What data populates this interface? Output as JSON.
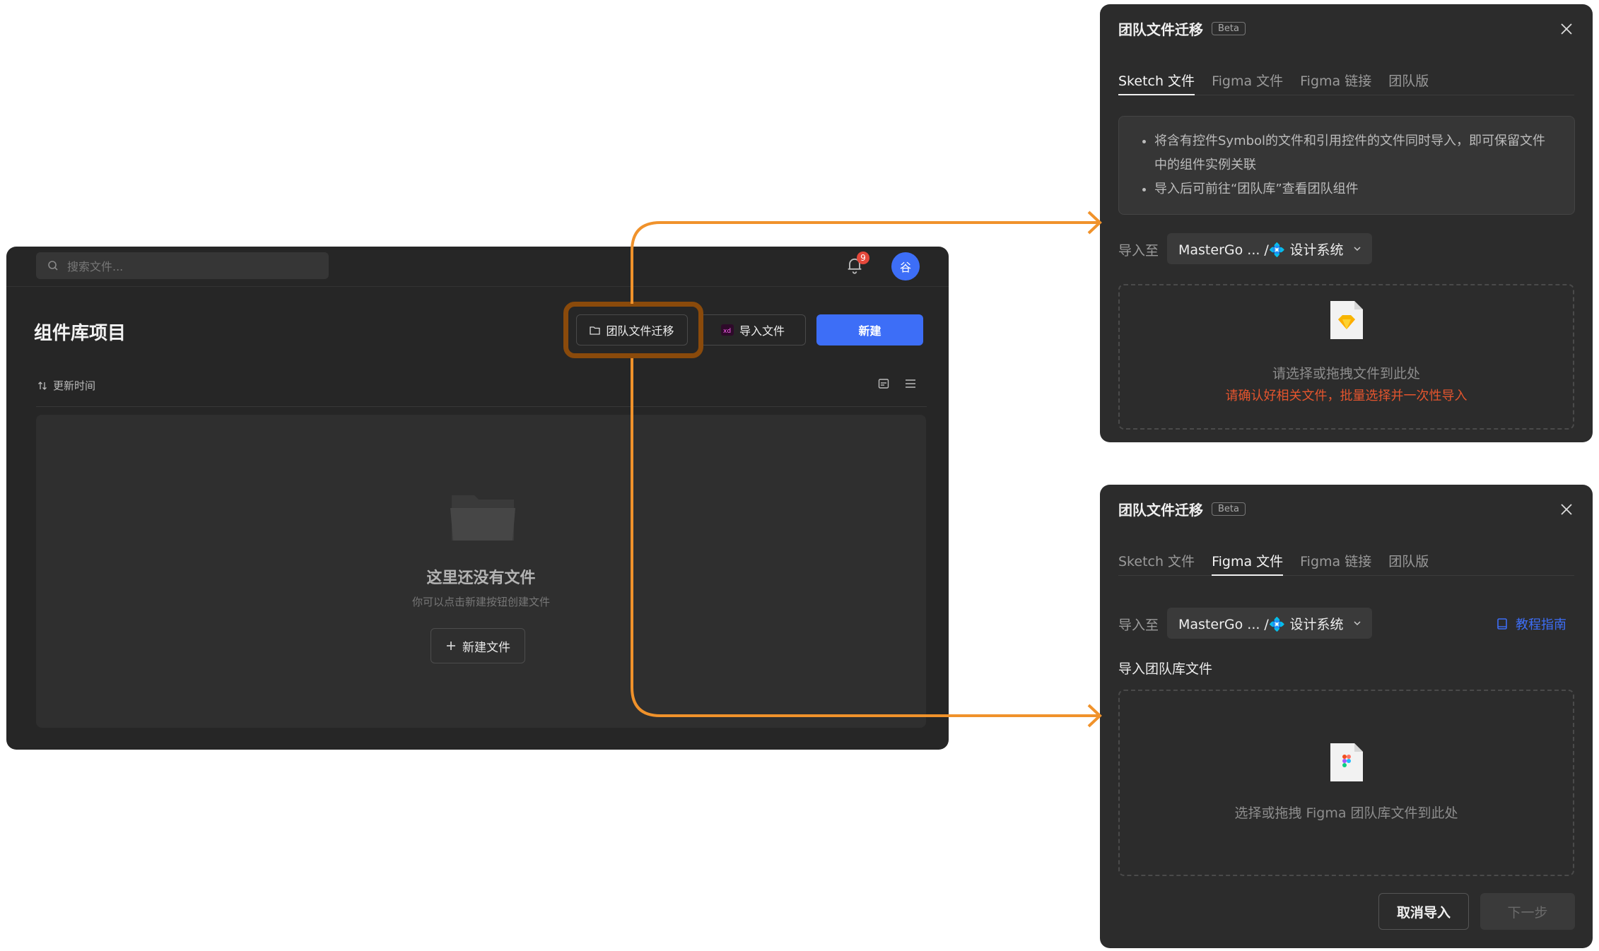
{
  "main": {
    "search_placeholder": "搜索文件...",
    "notification_count": "9",
    "avatar_initial": "谷",
    "page_title": "组件库项目",
    "buttons": {
      "migrate": "团队文件迁移",
      "import": "导入文件",
      "new": "新建"
    },
    "sort_label": "更新时间",
    "empty": {
      "title": "这里还没有文件",
      "subtitle": "你可以点击新建按钮创建文件",
      "new_file_button": "新建文件"
    }
  },
  "dialog_sketch": {
    "title": "团队文件迁移",
    "beta": "Beta",
    "tabs": [
      "Sketch 文件",
      "Figma 文件",
      "Figma 链接",
      "团队版"
    ],
    "active_tab": 0,
    "info": [
      "将含有控件Symbol的文件和引用控件的文件同时导入，即可保留文件中的组件实例关联",
      "导入后可前往“团队库”查看团队组件"
    ],
    "import_to_label": "导入至",
    "import_to_value": "MasterGo ... /💠 设计系统",
    "drop_text": "请选择或拖拽文件到此处",
    "drop_warning": "请确认好相关文件，批量选择并一次性导入"
  },
  "dialog_figma": {
    "title": "团队文件迁移",
    "beta": "Beta",
    "tabs": [
      "Sketch 文件",
      "Figma 文件",
      "Figma 链接",
      "团队版"
    ],
    "active_tab": 1,
    "import_to_label": "导入至",
    "import_to_value": "MasterGo ... /💠 设计系统",
    "guide": "教程指南",
    "section_label": "导入团队库文件",
    "drop_text": "选择或拖拽 Figma 团队库文件到此处",
    "cancel": "取消导入",
    "next": "下一步"
  },
  "colors": {
    "accent": "#3d6ef7",
    "arrow": "#f0922b",
    "highlight": "#8a4a0b",
    "warning": "#e5552e"
  }
}
